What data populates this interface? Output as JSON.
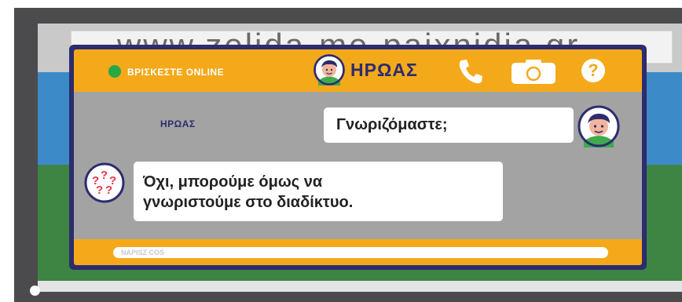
{
  "browser": {
    "url": "www.zelida-me-paixnidia.gr"
  },
  "chat": {
    "header": {
      "status_text": "ΒΡΙΣΚΕΣΤΕ ONLINE",
      "contact_name": "ΗΡΩΑΣ",
      "icons": [
        "phone-icon",
        "camera-icon",
        "help-icon"
      ],
      "help_symbol": "?"
    },
    "messages": [
      {
        "side": "right",
        "sender": "ΗΡΩΑΣ",
        "text": "Γνωριζόμαστε;",
        "avatar": "boy-avatar-icon"
      },
      {
        "side": "left",
        "lines": [
          "Όχι, μπορούμε όμως να",
          "γνωριστούμε στο διαδίκτυο."
        ],
        "avatar": "question-marks-avatar-icon"
      }
    ],
    "input": {
      "placeholder": "NAPISZ COŚ",
      "value": ""
    }
  },
  "colors": {
    "frame": "#4b4b4d",
    "header": "#f4a91a",
    "border": "#2c2c6e",
    "body": "#a3a3a3",
    "online": "#27a845",
    "sky": "#3d8ac9",
    "grass": "#3e8443"
  }
}
